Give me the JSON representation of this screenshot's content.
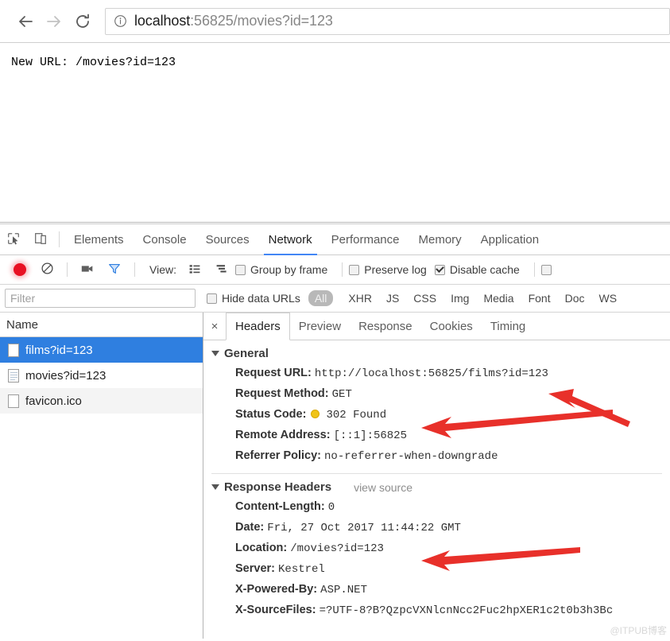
{
  "browser": {
    "back_icon": "arrow-left-icon",
    "forward_icon": "arrow-right-icon",
    "reload_icon": "reload-icon",
    "info_icon": "info-circle-icon",
    "url_host": "localhost",
    "url_rest": ":56825/movies?id=123",
    "url_full": "localhost:56825/movies?id=123"
  },
  "page": {
    "body_text": "New URL: /movies?id=123"
  },
  "devtools": {
    "inspect_icon": "inspect-element-icon",
    "device_icon": "device-toolbar-icon",
    "tabs": [
      {
        "label": "Elements",
        "active": false
      },
      {
        "label": "Console",
        "active": false
      },
      {
        "label": "Sources",
        "active": false
      },
      {
        "label": "Network",
        "active": true
      },
      {
        "label": "Performance",
        "active": false
      },
      {
        "label": "Memory",
        "active": false
      },
      {
        "label": "Application",
        "active": false
      }
    ],
    "toolbar": {
      "record_icon": "record-button-icon",
      "clear_icon": "clear-button-icon",
      "camera_icon": "capture-screenshots-icon",
      "filter_icon": "filter-funnel-icon",
      "view_label": "View:",
      "view_list_icon": "view-list-icon",
      "view_waterfall_icon": "view-waterfall-icon",
      "group_by_frame": {
        "label": "Group by frame",
        "checked": false
      },
      "preserve_log": {
        "label": "Preserve log",
        "checked": false
      },
      "disable_cache": {
        "label": "Disable cache",
        "checked": true
      },
      "offline": {
        "label": "",
        "checked": false
      }
    },
    "filterbar": {
      "filter_placeholder": "Filter",
      "filter_value": "",
      "hide_data_urls": {
        "label": "Hide data URLs",
        "checked": false
      },
      "types": [
        {
          "label": "All",
          "selected": true
        },
        {
          "label": "XHR",
          "selected": false
        },
        {
          "label": "JS",
          "selected": false
        },
        {
          "label": "CSS",
          "selected": false
        },
        {
          "label": "Img",
          "selected": false
        },
        {
          "label": "Media",
          "selected": false
        },
        {
          "label": "Font",
          "selected": false
        },
        {
          "label": "Doc",
          "selected": false
        },
        {
          "label": "WS",
          "selected": false
        }
      ]
    },
    "requests": {
      "column_header": "Name",
      "rows": [
        {
          "name": "films?id=123",
          "icon": "blank-file-icon",
          "selected": true
        },
        {
          "name": "movies?id=123",
          "icon": "document-file-icon",
          "selected": false
        },
        {
          "name": "favicon.ico",
          "icon": "blank-file-icon",
          "selected": false
        }
      ]
    },
    "detail": {
      "close_label": "×",
      "tabs": [
        {
          "label": "Headers",
          "active": true
        },
        {
          "label": "Preview",
          "active": false
        },
        {
          "label": "Response",
          "active": false
        },
        {
          "label": "Cookies",
          "active": false
        },
        {
          "label": "Timing",
          "active": false
        }
      ],
      "general": {
        "title": "General",
        "rows": [
          {
            "name": "Request URL:",
            "value": "http://localhost:56825/films?id=123"
          },
          {
            "name": "Request Method:",
            "value": "GET"
          },
          {
            "name": "Status Code:",
            "value": "302 Found",
            "status_dot": "#f0c419"
          },
          {
            "name": "Remote Address:",
            "value": "[::1]:56825"
          },
          {
            "name": "Referrer Policy:",
            "value": "no-referrer-when-downgrade"
          }
        ]
      },
      "response_headers": {
        "title": "Response Headers",
        "view_source": "view source",
        "rows": [
          {
            "name": "Content-Length:",
            "value": "0"
          },
          {
            "name": "Date:",
            "value": "Fri, 27 Oct 2017 11:44:22 GMT"
          },
          {
            "name": "Location:",
            "value": "/movies?id=123"
          },
          {
            "name": "Server:",
            "value": "Kestrel"
          },
          {
            "name": "X-Powered-By:",
            "value": "ASP.NET"
          },
          {
            "name": "X-SourceFiles:",
            "value": "=?UTF-8?B?QzpcVXNlcnNcc2Fuc2hpXER1c2t0b3h3Bc"
          }
        ]
      }
    }
  },
  "annotations": {
    "arrow_color": "#e8302a",
    "arrows": [
      {
        "name": "arrow-request-url"
      },
      {
        "name": "arrow-status-code"
      },
      {
        "name": "arrow-location-header"
      }
    ]
  },
  "watermark": {
    "text": "@ITPUB博客"
  }
}
